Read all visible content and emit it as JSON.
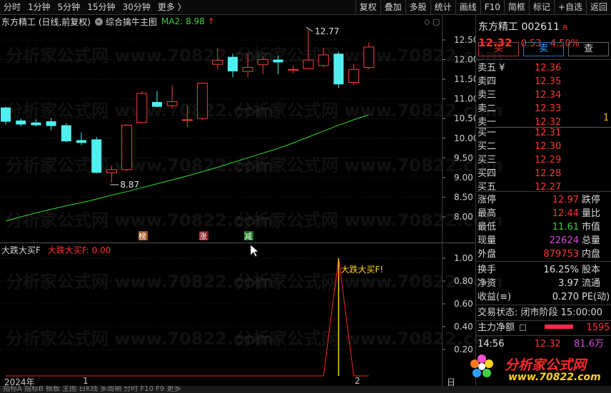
{
  "toolbar": {
    "left": [
      "分时",
      "1分钟",
      "5分钟",
      "15分钟",
      "30分钟",
      "更多 〉"
    ],
    "right": [
      "复权",
      "叠加",
      "多股",
      "统计",
      "画线",
      "F10",
      "简框",
      "标记",
      "+自选",
      "返回"
    ]
  },
  "chart_header": {
    "stock": "东方精工 (日线,前复权)",
    "indicator": "综合擒牛主图",
    "ma2": "MA2: 8.98",
    "up_mark": "↑"
  },
  "sub_header": {
    "name": "大跌大买F",
    "value": "大跌大买F: 0.00"
  },
  "watermark": "分析家公式网 www.70822.com",
  "bottom_axis": {
    "year": "2024年",
    "m1": "1",
    "m2": "2",
    "right": "日线"
  },
  "bottom_tabs": "指标A  指标B  模板  主图  日K线  多周期  分时  F10  F9  更多",
  "chart_data": {
    "type": "candlestick",
    "y_ticks": [
      8.0,
      8.5,
      9.0,
      9.5,
      10.0,
      10.5,
      11.0,
      11.5,
      12.0,
      12.5
    ],
    "candles": [
      {
        "o": 10.78,
        "c": 10.42,
        "h": 10.8,
        "l": 10.35
      },
      {
        "o": 10.45,
        "c": 10.35,
        "h": 10.5,
        "l": 10.3
      },
      {
        "o": 10.4,
        "c": 10.33,
        "h": 10.48,
        "l": 10.3
      },
      {
        "o": 10.43,
        "c": 10.31,
        "h": 10.52,
        "l": 10.2
      },
      {
        "o": 10.33,
        "c": 9.92,
        "h": 10.38,
        "l": 9.9
      },
      {
        "o": 9.95,
        "c": 9.88,
        "h": 10.15,
        "l": 9.82
      },
      {
        "o": 9.97,
        "c": 9.12,
        "h": 10.03,
        "l": 9.1
      },
      {
        "o": 9.12,
        "c": 9.2,
        "h": 9.3,
        "l": 8.87
      },
      {
        "o": 9.2,
        "c": 10.33,
        "h": 10.35,
        "l": 9.17
      },
      {
        "o": 10.4,
        "c": 11.14,
        "h": 11.2,
        "l": 10.38
      },
      {
        "o": 10.92,
        "c": 10.8,
        "h": 11.2,
        "l": 10.78
      },
      {
        "o": 10.83,
        "c": 10.93,
        "h": 11.35,
        "l": 10.75
      },
      {
        "o": 10.45,
        "c": 10.47,
        "h": 10.82,
        "l": 10.28
      },
      {
        "o": 10.5,
        "c": 11.4,
        "h": 11.42,
        "l": 10.45
      },
      {
        "o": 11.88,
        "c": 11.98,
        "h": 12.3,
        "l": 11.75
      },
      {
        "o": 12.07,
        "c": 11.7,
        "h": 12.15,
        "l": 11.55
      },
      {
        "o": 11.7,
        "c": 11.8,
        "h": 12.15,
        "l": 11.55
      },
      {
        "o": 11.87,
        "c": 12.0,
        "h": 12.08,
        "l": 11.63
      },
      {
        "o": 12.0,
        "c": 11.93,
        "h": 12.1,
        "l": 11.63
      },
      {
        "o": 11.73,
        "c": 11.75,
        "h": 11.85,
        "l": 11.65
      },
      {
        "o": 11.77,
        "c": 11.99,
        "h": 12.77,
        "l": 11.75
      },
      {
        "o": 11.85,
        "c": 12.12,
        "h": 12.3,
        "l": 11.8
      },
      {
        "o": 12.15,
        "c": 11.37,
        "h": 12.2,
        "l": 11.28
      },
      {
        "o": 11.42,
        "c": 11.75,
        "h": 11.9,
        "l": 11.35
      },
      {
        "o": 11.8,
        "c": 12.32,
        "h": 12.44,
        "l": 11.75
      }
    ],
    "ma2": [
      7.89,
      8.0,
      8.1,
      8.19,
      8.28,
      8.36,
      8.45,
      8.55,
      8.64,
      8.74,
      8.84,
      8.94,
      9.04,
      9.15,
      9.26,
      9.38,
      9.5,
      9.62,
      9.74,
      9.88,
      10.03,
      10.18,
      10.33,
      10.47,
      10.6
    ],
    "annotations": {
      "high": "12.77",
      "low": "8.87"
    },
    "markers": [
      "榜",
      "涨",
      "减"
    ],
    "sub": {
      "y_ticks": [
        "1.00",
        "0.80",
        "0.60",
        "0.40",
        "0.20"
      ],
      "spike_label": "大跌大买F!",
      "signal_values": [
        0,
        0,
        0,
        0,
        0,
        0,
        0,
        0,
        0,
        0,
        0,
        0,
        0,
        0,
        0,
        0,
        0,
        0,
        0,
        0,
        0,
        0,
        1,
        0,
        0
      ]
    }
  },
  "right_panel": {
    "name": "东方精工 002611",
    "flag": "R",
    "price": "12.32",
    "change": "0.53",
    "pct": "4.50%",
    "buttons": {
      "buy": "买",
      "sell": "卖",
      "query": "查"
    },
    "asks": [
      {
        "label": "卖五 ¥",
        "price": "12.36"
      },
      {
        "label": "卖四",
        "price": "12.35"
      },
      {
        "label": "卖三",
        "price": "12.34"
      },
      {
        "label": "卖二",
        "price": "12.33"
      },
      {
        "label": "卖一",
        "price": "12.32"
      }
    ],
    "bids": [
      {
        "label": "买一",
        "price": "12.31"
      },
      {
        "label": "买二",
        "price": "12.30"
      },
      {
        "label": "买三",
        "price": "12.29"
      },
      {
        "label": "买四",
        "price": "12.28"
      },
      {
        "label": "买五",
        "price": "12.27"
      }
    ],
    "quotes": [
      {
        "l": "涨停",
        "v": "12.97",
        "c": "red",
        "l2": "跌停"
      },
      {
        "l": "最高",
        "v": "12.44",
        "c": "red",
        "l2": "量比"
      },
      {
        "l": "最低",
        "v": "11.61",
        "c": "green",
        "l2": "市值"
      },
      {
        "l": "现量",
        "v": "22624",
        "c": "pink",
        "l2": "总量"
      },
      {
        "l": "外盘",
        "v": "879753",
        "c": "red",
        "l2": "内盘"
      }
    ],
    "stats": [
      {
        "l": "换手",
        "v": "16.25%",
        "c": "white",
        "l2": "股本"
      },
      {
        "l": "净资",
        "v": "3.97",
        "c": "white",
        "l2": "流通"
      },
      {
        "l": "收益(≡)",
        "v": "0.270",
        "c": "white",
        "l2": "PE(动)"
      }
    ],
    "status": "交易状态: 闭市阶段 15:00:00",
    "net_label": "主力净额",
    "net_value": "1595",
    "tick": {
      "time": "14:56",
      "price": "12.32",
      "vol": "81.6万"
    },
    "ask_one_volume_fragment": "1"
  },
  "logo": {
    "text": "分析家公式网",
    "url": "www.70822.com"
  }
}
